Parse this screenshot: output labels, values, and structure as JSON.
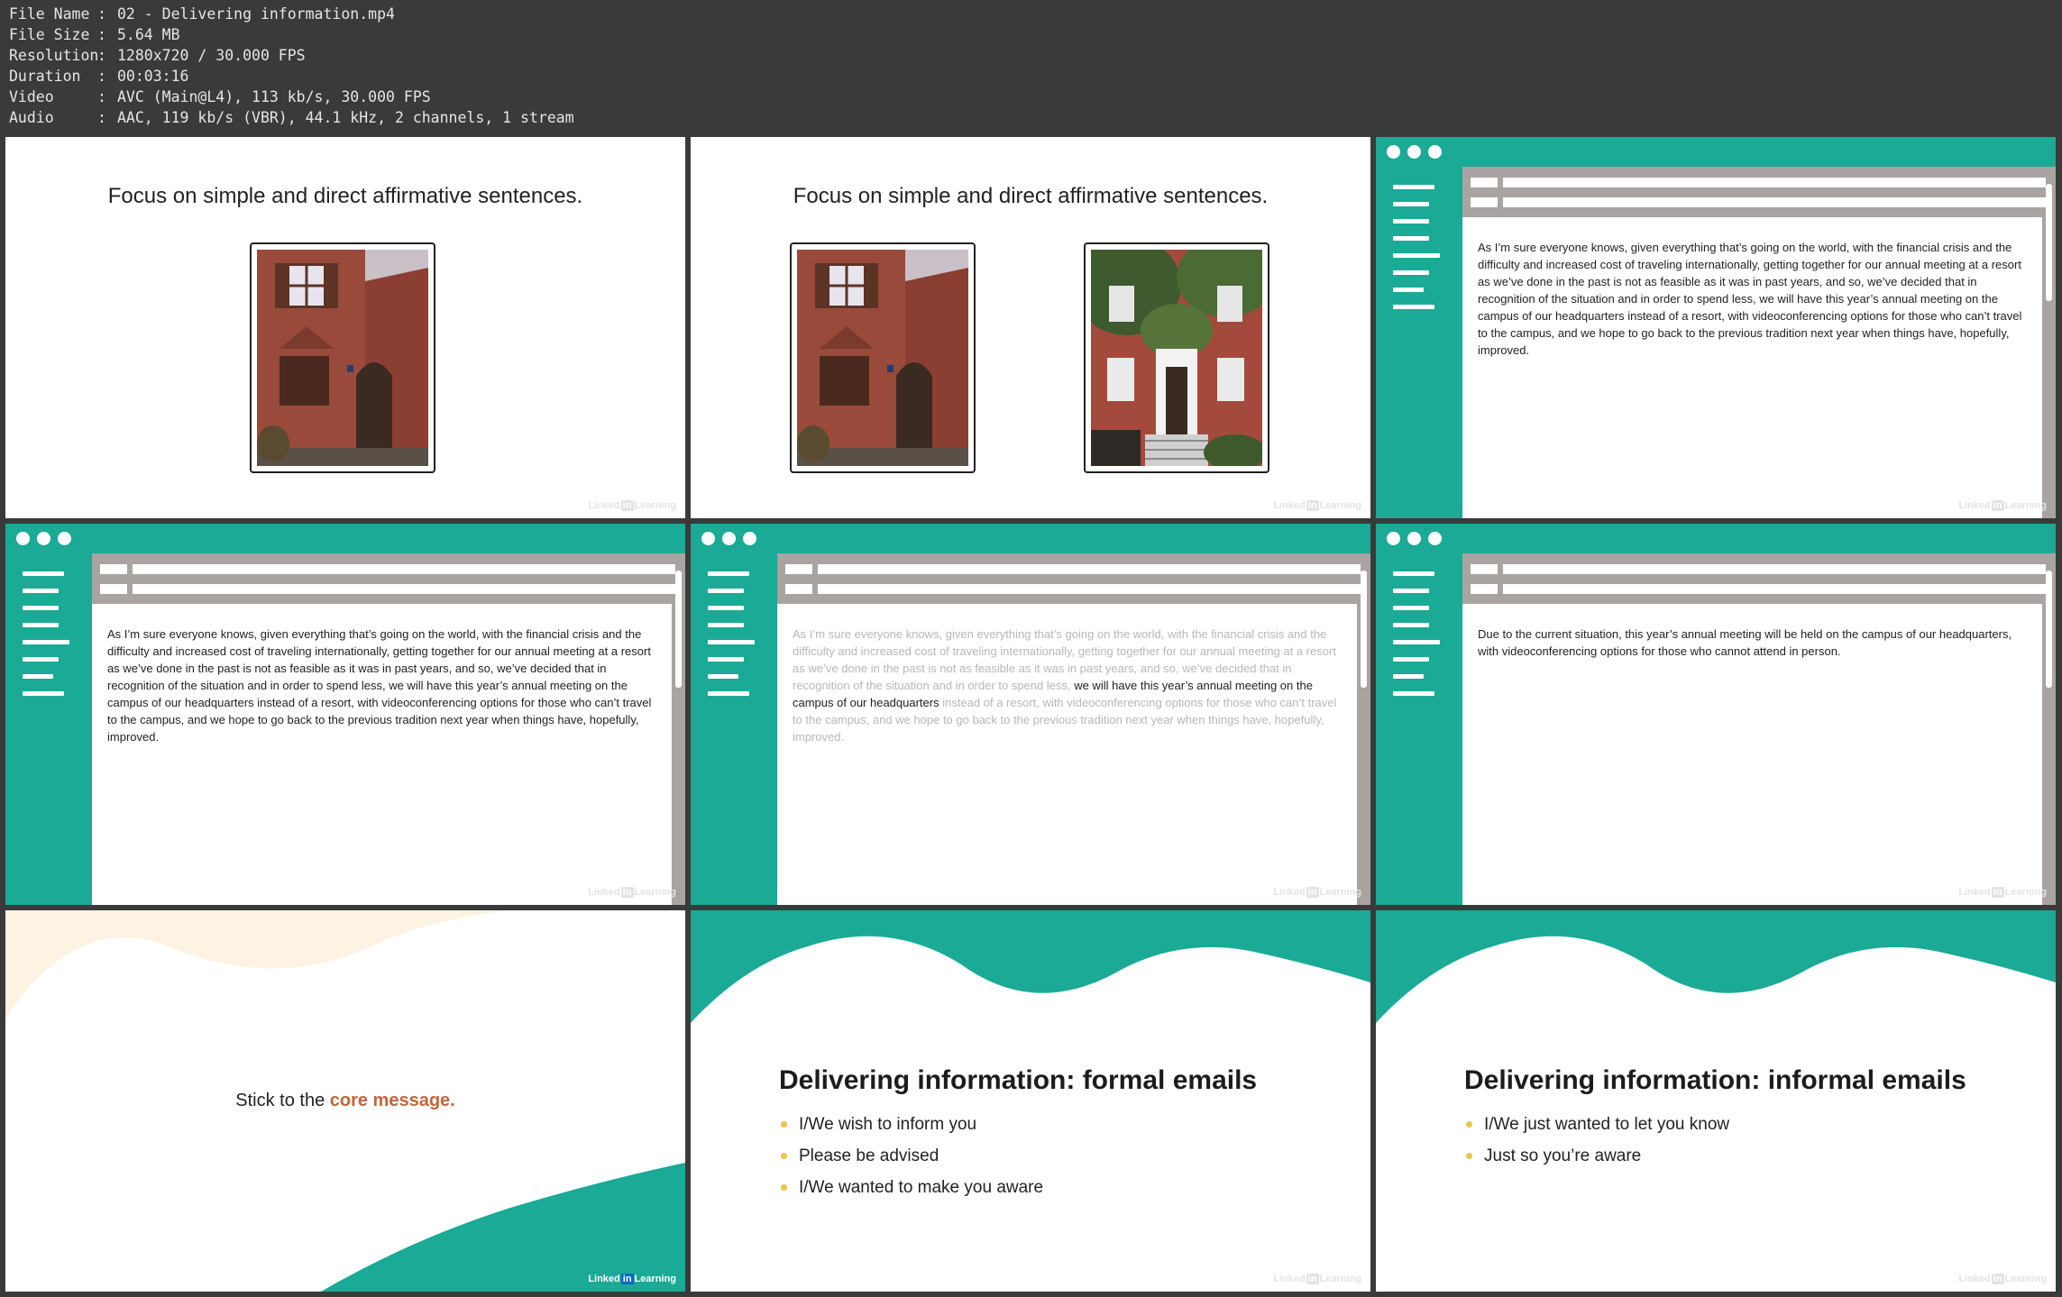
{
  "meta": [
    {
      "key": "File Name",
      "value": "02 - Delivering information.mp4"
    },
    {
      "key": "File Size",
      "value": "5.64 MB"
    },
    {
      "key": "Resolution",
      "value": "1280x720 / 30.000 FPS"
    },
    {
      "key": "Duration",
      "value": "00:03:16"
    },
    {
      "key": "Video",
      "value": "AVC (Main@L4), 113 kb/s, 30.000 FPS"
    },
    {
      "key": "Audio",
      "value": "AAC, 119 kb/s (VBR), 44.1 kHz, 2 channels, 1 stream"
    }
  ],
  "watermark": {
    "pre": "Linked",
    "in": "in",
    "post": "Learning"
  },
  "slides": {
    "focus_title": "Focus on simple and direct affirmative sentences.",
    "email_long": "As I’m sure everyone knows, given everything that’s going on the world, with the financial crisis and the difficulty and increased cost of traveling internationally, getting together for our annual meeting at a resort as we’ve done in the past is not as feasible as it was in past years, and so, we’ve decided that in recognition of the situation and in order to spend less, we will have this year’s annual meeting on the campus of our headquarters instead of a resort, with videoconferencing options for those who can’t travel to the campus, and we hope to go back to the previous tradition next year when things have, hopefully, improved.",
    "email_dim_before": "As I’m sure everyone knows, given everything that’s going on the world, with the financial crisis and the difficulty and increased cost of traveling internationally, getting together for our annual meeting at a resort as we’ve done in the past is not as feasible as it was in past years, and so, we’ve decided that in recognition of the situation and in order to spend less, ",
    "email_highlight": "we will have this year’s annual meeting on the campus of our headquarters",
    "email_dim_after": " instead of a resort, with videoconferencing options for those who can’t travel to the campus, and we hope to go back to the previous tradition next year when things have, hopefully, improved.",
    "email_short": "Due to the current situation, this year’s annual meeting will be held on the campus of our headquarters, with videoconferencing options for those who cannot attend in person.",
    "core_pre": "Stick to the ",
    "core_accent": "core message.",
    "formal_title": "Delivering information: formal emails",
    "formal_items": [
      "I/We wish to inform you",
      "Please be advised",
      "I/We wanted to make you aware"
    ],
    "informal_title": "Delivering information: informal emails",
    "informal_items": [
      "I/We just wanted to let you know",
      "Just so you’re aware"
    ]
  },
  "colors": {
    "teal": "#1aaa96",
    "accent": "#c2663a",
    "bullet": "#f0c34c",
    "cream": "#fcf3e3",
    "gray": "#a9a3a1"
  }
}
